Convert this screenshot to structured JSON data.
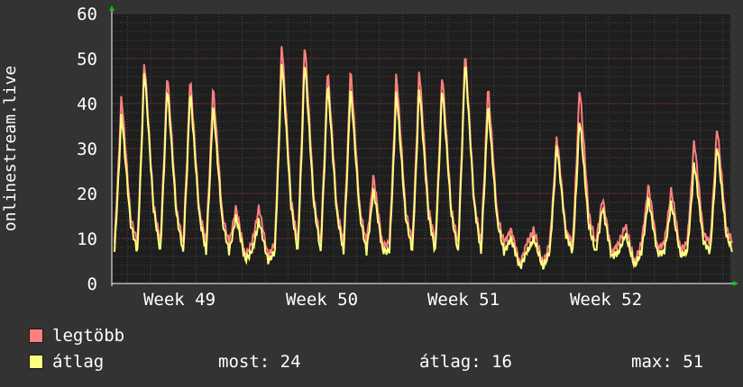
{
  "chart_data": {
    "type": "area",
    "ylabel": "onlinestream.live",
    "ylim": [
      0,
      60
    ],
    "yticks": [
      0,
      10,
      20,
      30,
      40,
      50,
      60
    ],
    "xticks": [
      "Week 49",
      "Week 50",
      "Week 51",
      "Week 52"
    ],
    "grid": true,
    "colors": {
      "background": "#333333",
      "plot": "#1e1e1e",
      "grid": "#555555",
      "arrow": "#00cc00"
    },
    "series": [
      {
        "name": "legtöbb",
        "color": "#ff7f7f",
        "daily_peaks": [
          42,
          50,
          47,
          46,
          44,
          17,
          17,
          54,
          54,
          48,
          48,
          24,
          47,
          48,
          47,
          52,
          44,
          12,
          12,
          33,
          44,
          19,
          13,
          22,
          21,
          32,
          35
        ]
      },
      {
        "name": "átlag",
        "color": "#ffff80",
        "daily_peaks": [
          38,
          48,
          44,
          43,
          40,
          15,
          14,
          50,
          50,
          45,
          44,
          21,
          43,
          44,
          44,
          50,
          40,
          10,
          10,
          31,
          37,
          17,
          11,
          19,
          18,
          27,
          31
        ]
      }
    ],
    "legend": [
      {
        "label": "legtöbb",
        "color": "#ff7f7f"
      },
      {
        "label": "átlag",
        "color": "#ffff80"
      }
    ],
    "stats": {
      "most": "most: 24",
      "atlag": "átlag: 16",
      "max": "max: 51"
    }
  }
}
